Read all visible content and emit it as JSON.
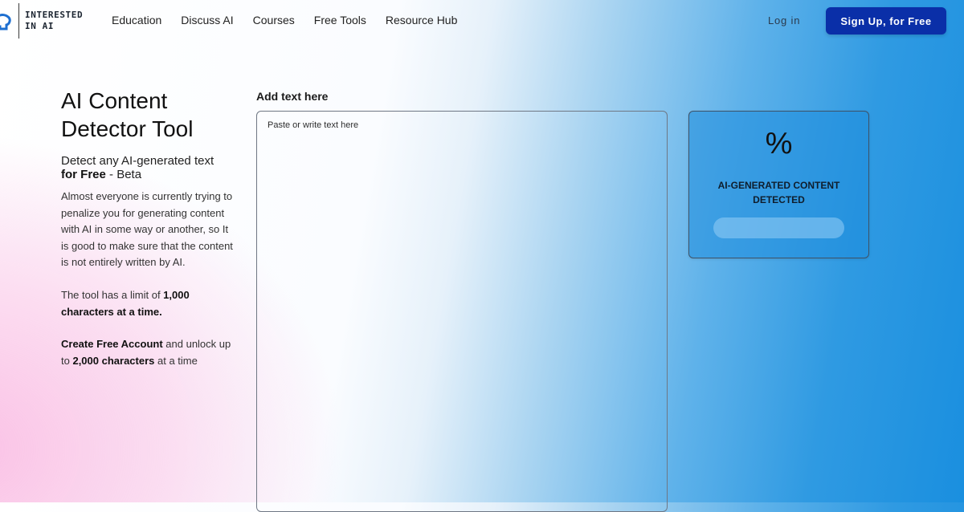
{
  "header": {
    "logo_line1": "INTERESTED",
    "logo_line2": "IN AI",
    "nav": [
      "Education",
      "Discuss AI",
      "Courses",
      "Free Tools",
      "Resource Hub"
    ],
    "login_label": "Log in",
    "signup_label": "Sign Up, for Free",
    "colors": {
      "signup_bg": "#0a2fa8",
      "logo_blue": "#1e6fd0"
    }
  },
  "intro": {
    "title_line1": "AI Content",
    "title_line2": "Detector Tool",
    "subtitle_plain": "Detect any AI-generated text",
    "subtitle_bold": "for Free",
    "subtitle_suffix": " - Beta",
    "description": "Almost everyone is currently trying to penalize you for generating content with AI in some way or another, so It is good to make sure that the content is not entirely written by AI.",
    "limit_prefix": "The tool has a limit of ",
    "limit_bold": "1,000 characters at a time.",
    "account_bold": "Create Free Account",
    "account_mid": " and unlock up to ",
    "account_bold2": "2,000 characters",
    "account_suffix": " at a time"
  },
  "editor": {
    "label": "Add text here",
    "placeholder": "Paste or write text here",
    "value": ""
  },
  "result": {
    "percent_text": "%",
    "label_line1": "AI-GENERATED CONTENT",
    "label_line2": "DETECTED",
    "progress": 0
  },
  "icons": {
    "logo": "head-silhouette-icon"
  }
}
